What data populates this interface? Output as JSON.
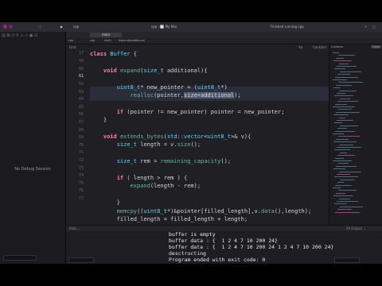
{
  "toolbar": {
    "scheme": "cpp",
    "run_target": "cpp › ⬜ My Mac",
    "status": "Finished running cpp"
  },
  "tabs": [
    {
      "label": "main"
    }
  ],
  "breadcrumb": [
    "cpp",
    "cpp",
    "main",
    "expand(additional)"
  ],
  "sidebar": {
    "no_debug_label": "No Debug Session"
  },
  "editor": {
    "filter_label": "Find",
    "right_controls": [
      "Aa",
      "Contains",
      "Done"
    ],
    "gutter": [
      "17",
      "59",
      "60",
      "61",
      "62",
      "63",
      "64",
      "65",
      "66",
      "67",
      "68",
      "69",
      "70",
      "71",
      "72",
      "73",
      "74",
      "75",
      "76",
      "77"
    ],
    "current_line": "61"
  },
  "code_lines": [
    {
      "pieces": [
        [
          "kw",
          "class "
        ],
        [
          "ty",
          "Buffer"
        ],
        [
          "pl",
          " {"
        ]
      ]
    },
    {
      "pieces": [
        [
          "pl",
          ""
        ]
      ]
    },
    {
      "pieces": [
        [
          "pl",
          "    "
        ],
        [
          "kw",
          "void "
        ],
        [
          "fn",
          "expand"
        ],
        [
          "pl",
          "("
        ],
        [
          "ty",
          "size_t"
        ],
        [
          "pl",
          " additional){"
        ]
      ]
    },
    {
      "pieces": [
        [
          "pl",
          ""
        ]
      ]
    },
    {
      "pieces": [
        [
          "pl",
          "        "
        ],
        [
          "ty",
          "uint8_t"
        ],
        [
          "pl",
          "* new_pointer = ("
        ],
        [
          "ty",
          "uint8_t"
        ],
        [
          "pl",
          "*)"
        ]
      ]
    },
    {
      "pieces": [
        [
          "pl",
          "            "
        ],
        [
          "fn",
          "realloc"
        ],
        [
          "pl",
          "(pointer,"
        ],
        [
          "sel",
          "size+additional"
        ],
        [
          "pl",
          ");"
        ]
      ]
    },
    {
      "pieces": [
        [
          "pl",
          ""
        ]
      ]
    },
    {
      "pieces": [
        [
          "pl",
          "        "
        ],
        [
          "kw",
          "if"
        ],
        [
          "pl",
          " (pointer != new_pointer) pointer = new_pointer;"
        ]
      ]
    },
    {
      "pieces": [
        [
          "pl",
          "    }"
        ]
      ]
    },
    {
      "pieces": [
        [
          "pl",
          ""
        ]
      ]
    },
    {
      "pieces": [
        [
          "pl",
          "    "
        ],
        [
          "kw",
          "void "
        ],
        [
          "fn",
          "extends_bytes"
        ],
        [
          "pl",
          "("
        ],
        [
          "ty",
          "std"
        ],
        [
          "pl",
          "::"
        ],
        [
          "ty",
          "vector"
        ],
        [
          "pl",
          "<"
        ],
        [
          "ty",
          "uint8_t"
        ],
        [
          "pl",
          ">& v){"
        ]
      ]
    },
    {
      "pieces": [
        [
          "pl",
          "        "
        ],
        [
          "ty",
          "size_t"
        ],
        [
          "pl",
          " length = v."
        ],
        [
          "fn",
          "size"
        ],
        [
          "pl",
          "();"
        ]
      ]
    },
    {
      "pieces": [
        [
          "pl",
          ""
        ]
      ]
    },
    {
      "pieces": [
        [
          "pl",
          "        "
        ],
        [
          "ty",
          "size_t"
        ],
        [
          "pl",
          " rem = "
        ],
        [
          "fn",
          "remaining_capacity"
        ],
        [
          "pl",
          "();"
        ]
      ]
    },
    {
      "pieces": [
        [
          "pl",
          ""
        ]
      ]
    },
    {
      "pieces": [
        [
          "pl",
          "        "
        ],
        [
          "kw",
          "if"
        ],
        [
          "pl",
          " ( length > rem ) {"
        ]
      ]
    },
    {
      "pieces": [
        [
          "pl",
          "            "
        ],
        [
          "fn",
          "expand"
        ],
        [
          "pl",
          "(length - rem);"
        ]
      ]
    },
    {
      "pieces": [
        [
          "pl",
          ""
        ]
      ]
    },
    {
      "pieces": [
        [
          "pl",
          "        }"
        ]
      ]
    },
    {
      "pieces": [
        [
          "pl",
          "        "
        ],
        [
          "fn",
          "memcpy"
        ],
        [
          "pl",
          "(("
        ],
        [
          "ty",
          "uint8_t"
        ],
        [
          "pl",
          "*)&pointer[filled_length],v."
        ],
        [
          "fn",
          "data"
        ],
        [
          "pl",
          "(),length);"
        ]
      ]
    },
    {
      "pieces": [
        [
          "pl",
          "        filled_length = filled_length + length;"
        ]
      ]
    }
  ],
  "debug": {
    "frame_label": "Auto ⌄",
    "output_label": "All Output ⌄"
  },
  "console_lines": [
    "buffer is empty",
    "buffer data : {  1 2 4 7 10 200 24}",
    "buffer data : {  1 2 4 7 10 200 24 1 2 4 7 10 200 24}",
    "desctructing",
    "Program ended with exit code: 0"
  ],
  "colors": {
    "keyword": "#ff7ab2",
    "type": "#5dd8ff",
    "function": "#67b7a4",
    "selection": "#515b70",
    "editor_bg": "#1f1f24"
  }
}
